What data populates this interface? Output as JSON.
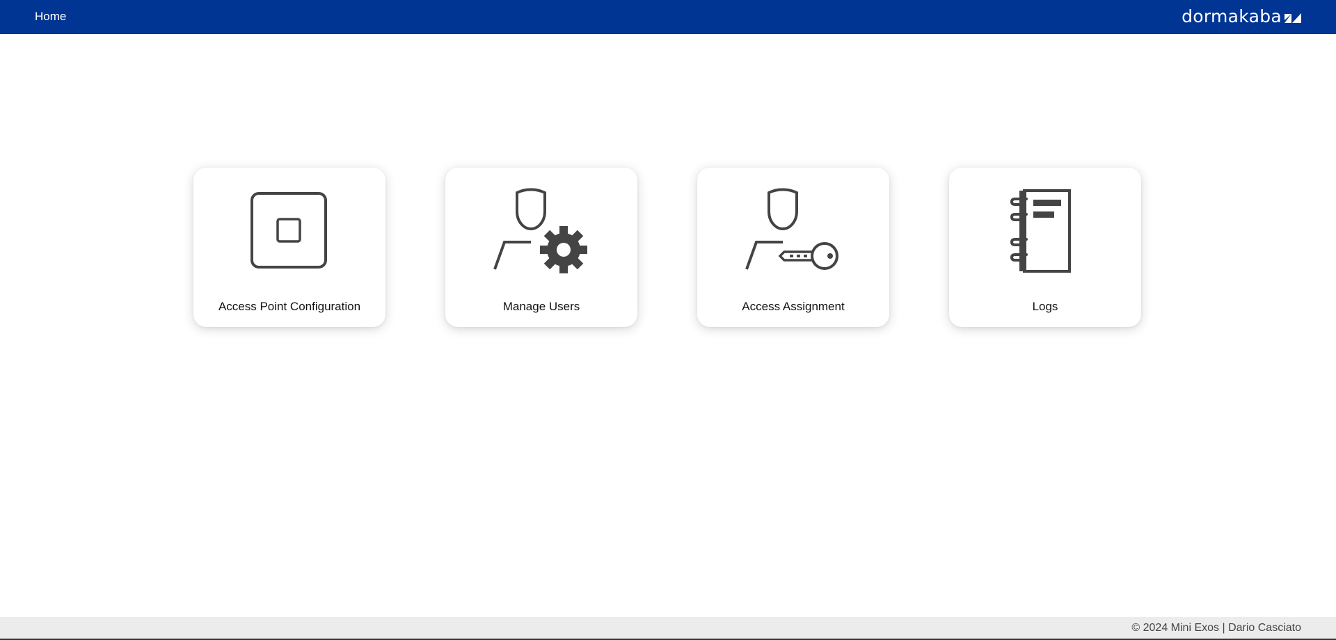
{
  "header": {
    "nav_home": "Home",
    "brand": "dormakaba",
    "brand_color": "#003594"
  },
  "tiles": [
    {
      "label": "Access Point Configuration",
      "icon": "access-point-icon"
    },
    {
      "label": "Manage Users",
      "icon": "user-gear-icon"
    },
    {
      "label": "Access Assignment",
      "icon": "user-key-icon"
    },
    {
      "label": "Logs",
      "icon": "notebook-icon"
    }
  ],
  "footer": {
    "text": "© 2024 Mini Exos | Dario Casciato"
  },
  "colors": {
    "icon": "#444444",
    "footer_bg": "#ececec"
  }
}
